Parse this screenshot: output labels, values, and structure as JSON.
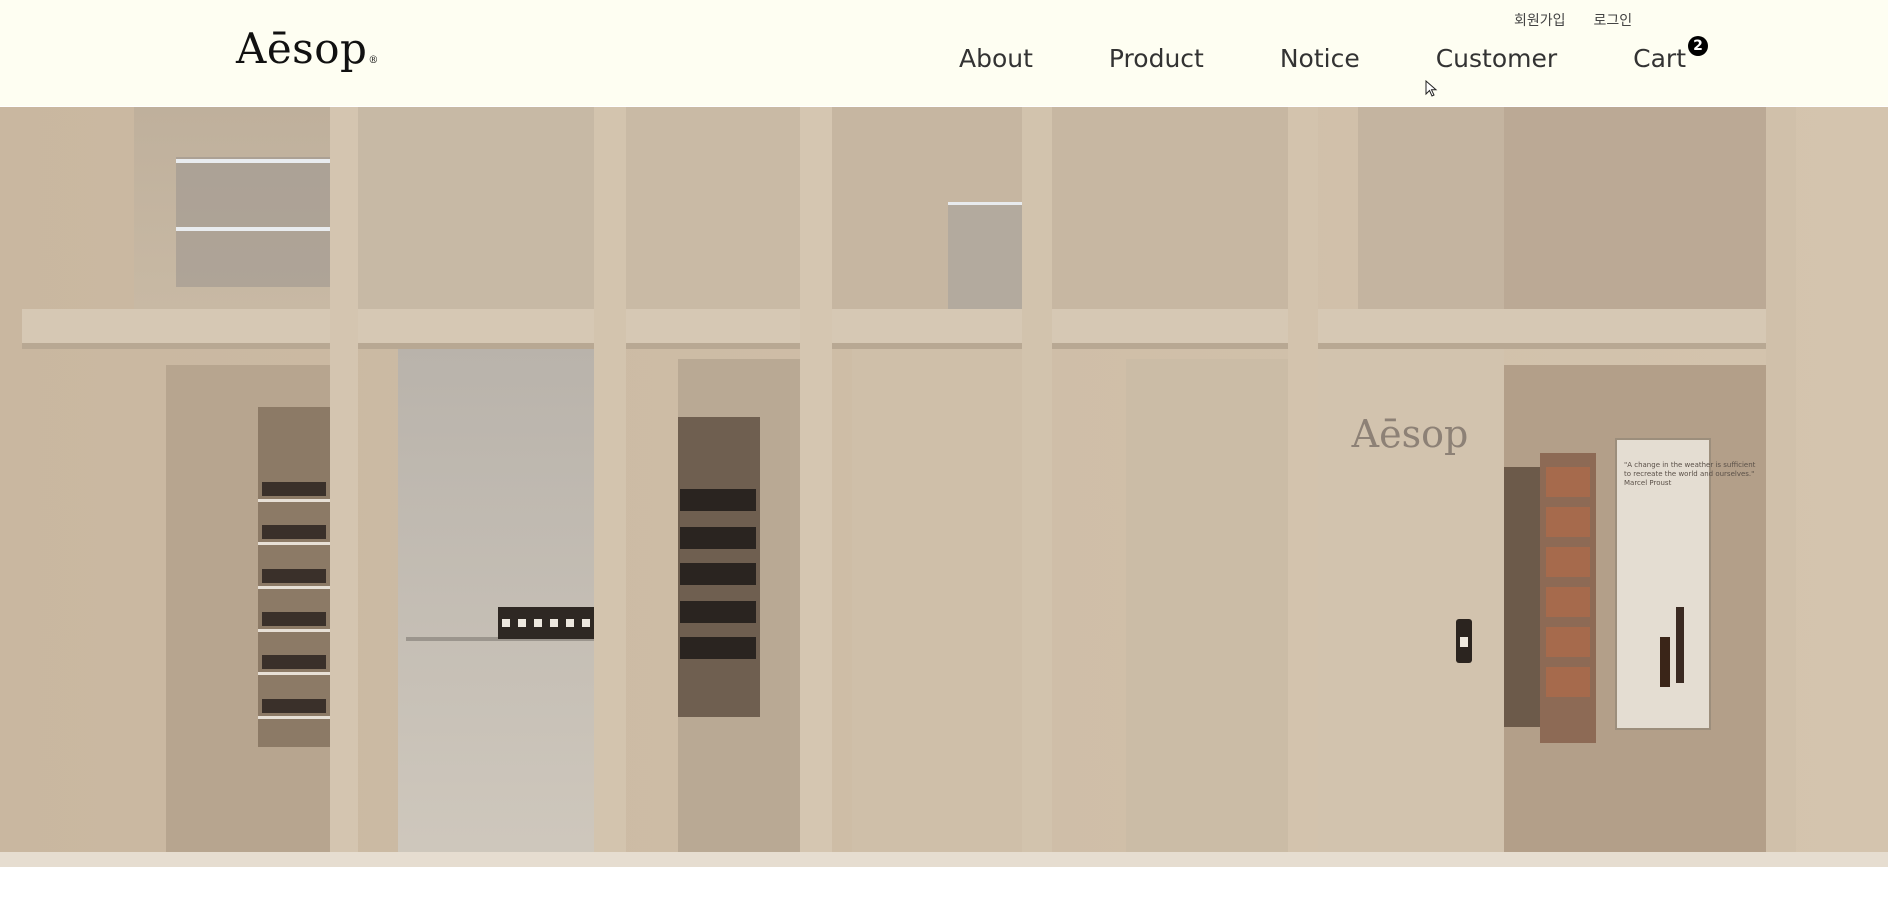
{
  "header": {
    "brand": "Aēsop",
    "brand_mark": "®",
    "util_nav": [
      {
        "label": "회원가입"
      },
      {
        "label": "로그인"
      }
    ],
    "main_nav": [
      {
        "label": "About"
      },
      {
        "label": "Product"
      },
      {
        "label": "Notice"
      },
      {
        "label": "Customer"
      },
      {
        "label": "Cart",
        "badge": "2"
      }
    ]
  },
  "hero": {
    "image": "aesop-store-facade",
    "wall_sign": "Aēsop",
    "poster_text": "\"A change in the weather is sufficient to recreate the world and ourselves.\" Marcel Proust"
  },
  "colors": {
    "header_bg": "#fefef2",
    "text": "#333333",
    "badge_bg": "#000000",
    "wood": "#cdbca6"
  }
}
